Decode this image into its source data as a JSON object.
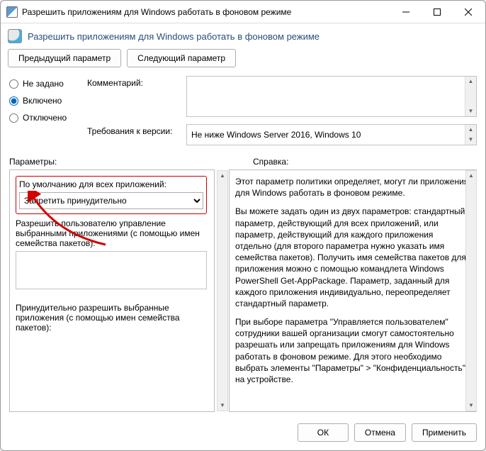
{
  "window": {
    "title": "Разрешить приложениям для Windows работать в фоновом режиме"
  },
  "header": {
    "text": "Разрешить приложениям для Windows работать в фоновом режиме"
  },
  "nav": {
    "prev": "Предыдущий параметр",
    "next": "Следующий параметр"
  },
  "state": {
    "not_configured": "Не задано",
    "enabled": "Включено",
    "disabled": "Отключено",
    "selected": "enabled"
  },
  "meta": {
    "comment_label": "Комментарий:",
    "comment_value": "",
    "req_label": "Требования к версии:",
    "req_value": "Не ниже Windows Server 2016, Windows 10"
  },
  "section_labels": {
    "options": "Параметры:",
    "help": "Справка:"
  },
  "options": {
    "default_label": "По умолчанию для всех приложений:",
    "default_value": "Запретить принудительно",
    "default_choices": [
      "Запретить принудительно"
    ],
    "user_choice_label": "Разрешить пользователю управление выбранными приложениями (с помощью имен семейства пакетов):",
    "force_allow_label": "Принудительно разрешить выбранные приложения (с помощью имен семейства пакетов):"
  },
  "help": {
    "p1": "Этот параметр политики определяет, могут ли приложения для Windows работать в фоновом режиме.",
    "p2": "Вы можете задать один из двух параметров: стандартный параметр, действующий для всех приложений, или параметр, действующий для каждого приложения отдельно (для второго параметра нужно указать имя семейства пакетов). Получить имя семейства пакетов для приложения можно с помощью командлета Windows PowerShell Get-AppPackage. Параметр, заданный для каждого приложения индивидуально, переопределяет стандартный параметр.",
    "p3": "При выборе параметра \"Управляется пользователем\" сотрудники вашей организации смогут самостоятельно разрешать или запрещать приложениям для Windows работать в фоновом режиме. Для этого необходимо выбрать элементы \"Параметры\" > \"Конфиденциальность\" на устройстве."
  },
  "footer": {
    "ok": "ОК",
    "cancel": "Отмена",
    "apply": "Применить"
  }
}
